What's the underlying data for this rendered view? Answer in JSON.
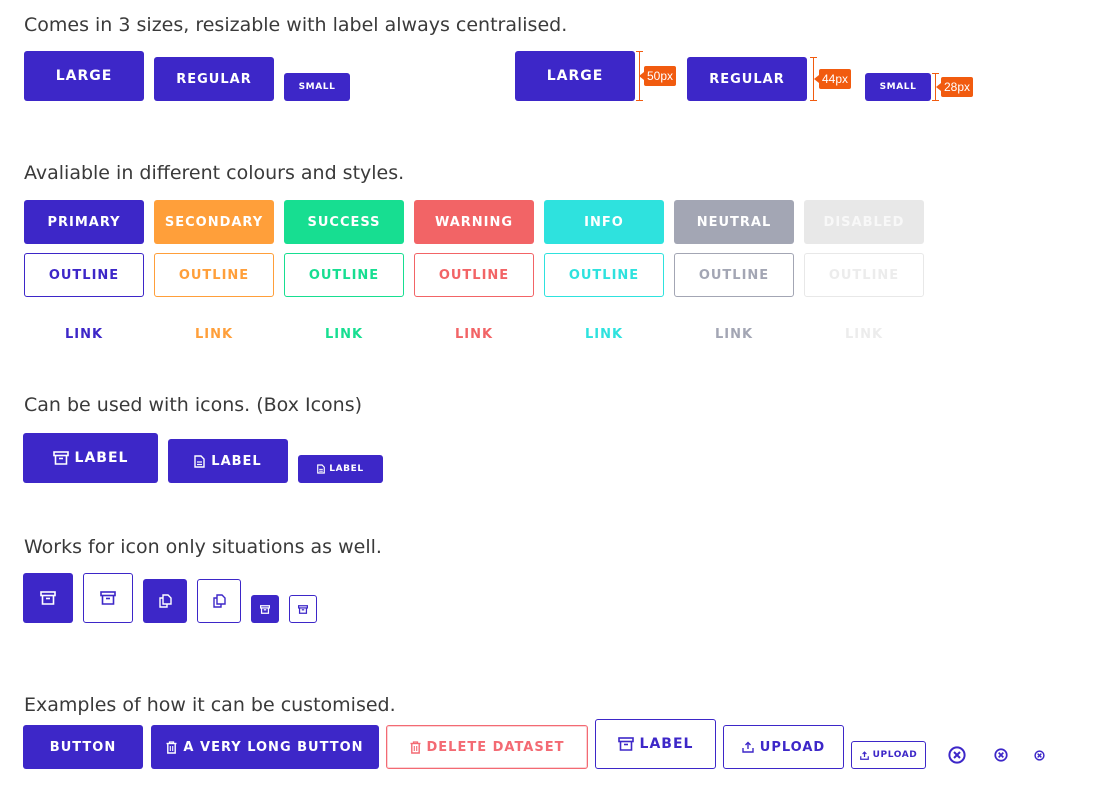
{
  "colors": {
    "primary": "#3d27c8",
    "secondary": "#ff9f3a",
    "success": "#17de91",
    "warning": "#f26466",
    "info": "#2ee2de",
    "neutral": "#a3a6b4",
    "disabled": "#e8e8e8",
    "disabled_text": "#f4f4f4",
    "dimension": "#f15b0f",
    "delete": "#f36a73"
  },
  "sections": {
    "sizes": "Comes in 3 sizes, resizable with label always centralised.",
    "colours": "Avaliable in different colours and styles.",
    "icons": "Can be used with icons. (Box Icons)",
    "icon_only": "Works for icon only situations as well.",
    "custom": "Examples of how it can be customised."
  },
  "sizes": {
    "large": "LARGE",
    "regular": "REGULAR",
    "small": "SMALL",
    "dim_large": "50px",
    "dim_regular": "44px",
    "dim_small": "28px"
  },
  "variants": {
    "primary": "PRIMARY",
    "secondary": "SECONDARY",
    "success": "SUCCESS",
    "warning": "WARNING",
    "info": "INFO",
    "neutral": "NEUTRAL",
    "disabled": "DISABLED",
    "outline": "OUTLINE",
    "link": "LINK"
  },
  "icon_buttons": {
    "label": "LABEL",
    "icons": [
      "archive-icon",
      "file-icon"
    ]
  },
  "custom": {
    "button": "BUTTON",
    "long": "A VERY LONG BUTTON",
    "delete": "DELETE DATASET",
    "label": "LABEL",
    "upload": "UPLOAD",
    "upload_small": "UPLOAD",
    "icons": [
      "trash-icon",
      "upload-icon",
      "close-circle-icon"
    ]
  }
}
